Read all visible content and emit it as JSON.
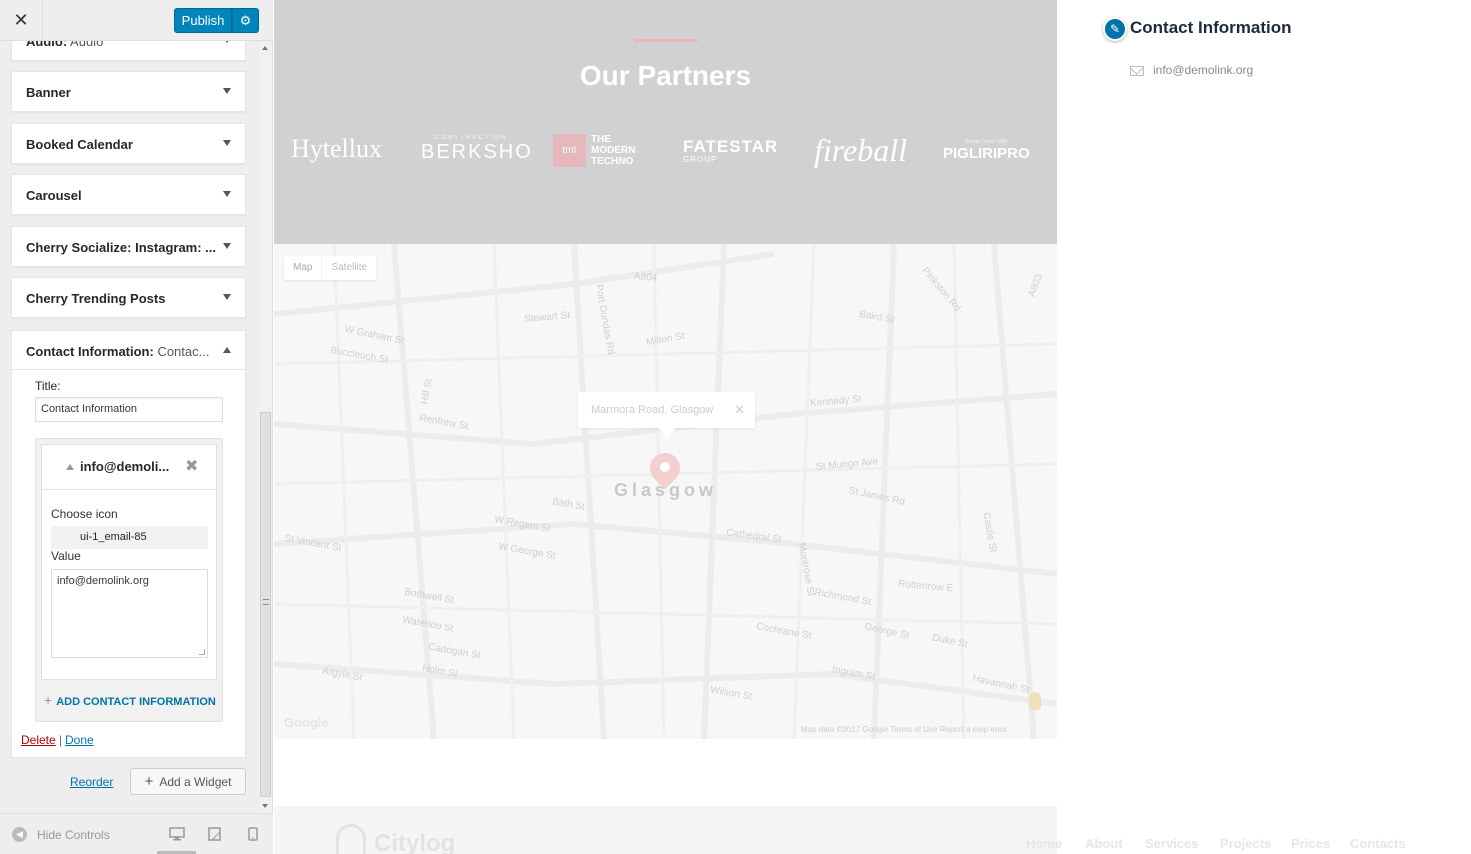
{
  "toolbar": {
    "close_label": "✕",
    "publish_label": "Publish",
    "settings_label": "⚙"
  },
  "widgets": [
    {
      "label": "Audio:",
      "sub": " Audio"
    },
    {
      "label": "Banner",
      "sub": ""
    },
    {
      "label": "Booked Calendar",
      "sub": ""
    },
    {
      "label": "Carousel",
      "sub": ""
    },
    {
      "label": "Cherry Socialize: Instagram: ...",
      "sub": ""
    },
    {
      "label": "Cherry Trending Posts",
      "sub": ""
    }
  ],
  "contact_widget": {
    "label": "Contact Information:",
    "sub": " Contac...",
    "title_label": "Title:",
    "title_value": "Contact Information",
    "item_title": "info@demoli...",
    "remove_label": "✖",
    "choose_icon_label": "Choose icon",
    "icon_value": "ui-1_email-85",
    "value_label": "Value",
    "value": "info@demolink.org",
    "add_label": "ADD CONTACT INFORMATION",
    "delete_label": "Delete",
    "separator": "|",
    "done_label": "Done"
  },
  "sidebar_footer": {
    "reorder_label": "Reorder",
    "add_widget_label": "Add a Widget",
    "hide_controls_label": "Hide Controls"
  },
  "partners": {
    "title": "Our Partners",
    "logos": [
      {
        "main": "Hytellux",
        "small": ""
      },
      {
        "main": "BERKSHO",
        "small": "CONSTRUCTION"
      },
      {
        "main": "THE MODERN TECHNO",
        "small": "tmt"
      },
      {
        "main": "FATESTAR",
        "small": "GROUP"
      },
      {
        "main": "fireball",
        "small": ""
      },
      {
        "main": "PIGLIRIPRO",
        "small": "Events Since 1986"
      }
    ]
  },
  "map": {
    "map_label": "Map",
    "satellite_label": "Satellite",
    "popup_text": "Marmora Road, Glasgow",
    "popup_close": "✕",
    "city": "Glasgow",
    "google_label": "Google",
    "attribution": "Map data ©2017 Google    Terms of Use    Report a map error",
    "streets": [
      "W Graham St",
      "Buccleuch St",
      "Hill St",
      "Renfrew St",
      "Bath St",
      "W Regent St",
      "W George St",
      "St Vincent St",
      "Bothwell St",
      "Waterloo St",
      "Cadogan St",
      "Holm St",
      "Argyle St",
      "Cathedral St",
      "St Mungo Ave",
      "St James Rd",
      "Kennedy St",
      "Milton St",
      "Stewart St",
      "Port Dundas Rd",
      "A804",
      "A803",
      "Baird St",
      "Cochrane St",
      "George St",
      "Duke St",
      "Richmond St",
      "Montrose St",
      "Castle St",
      "Rottenrow E",
      "Havannah St",
      "Ingram St",
      "Wilson St",
      "Pinkston Rd",
      "Hope St",
      "Pitt St",
      "Douglas St",
      "Holland St",
      "Elmbank St",
      "Garnet St",
      "Rose St",
      "Scott St",
      "Renfield St",
      "W Nile St",
      "N Hanover St",
      "Wellington St",
      "Queen St",
      "Hutcheson St",
      "John Knox St",
      "Drygate",
      "Wishart St",
      "Kirk St",
      "Lister St",
      "Glebe St",
      "Cowcaddens Rd",
      "Dobbie's Loan",
      "High St",
      "Parson St",
      "Black St",
      "Dunblane St",
      "Cambridge St",
      "Montrose St",
      "McAslin St",
      "Tennent St",
      "Sauchiehall St",
      "N Frederick St",
      "Martha St",
      "Baird St",
      "Lyon St",
      "Sighthill",
      "Fountainwell Rd",
      "Hopehill Rd",
      "Oxford St",
      "Howard St",
      "Ropework Ln",
      "Dunlop St"
    ]
  },
  "site_footer": {
    "logo": "Citylog",
    "nav": [
      "Home",
      "About",
      "Services",
      "Projects",
      "Prices",
      "Contacts"
    ]
  },
  "contact_info_preview": {
    "title": "Contact Information",
    "email": "info@demolink.org"
  }
}
